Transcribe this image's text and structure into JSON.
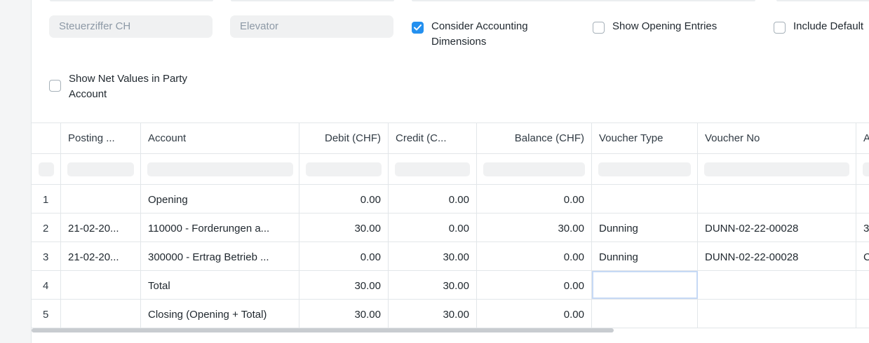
{
  "filters": {
    "tax_number_placeholder": "Steuerziffer CH",
    "elevator_placeholder": "Elevator",
    "checkboxes": [
      {
        "label": "Consider Accounting Dimensions",
        "checked": true
      },
      {
        "label": "Show Opening Entries",
        "checked": false
      },
      {
        "label": "Include Default",
        "checked": false
      },
      {
        "label": "Show Net Values in Party Account",
        "checked": false
      }
    ]
  },
  "table": {
    "columns": [
      "Posting ...",
      "Account",
      "Debit (CHF)",
      "Credit (C...",
      "Balance (CHF)",
      "Voucher Type",
      "Voucher No",
      "A"
    ],
    "rows": [
      {
        "num": "1",
        "posting": "",
        "account": "Opening",
        "debit": "0.00",
        "credit": "0.00",
        "balance": "0.00",
        "voucher_type": "",
        "voucher_no": "",
        "extra": ""
      },
      {
        "num": "2",
        "posting": "21-02-20...",
        "account": "110000 - Forderungen a...",
        "debit": "30.00",
        "credit": "0.00",
        "balance": "30.00",
        "voucher_type": "Dunning",
        "voucher_no": "DUNN-02-22-00028",
        "extra": "3"
      },
      {
        "num": "3",
        "posting": "21-02-20...",
        "account": "300000 - Ertrag Betrieb ...",
        "debit": "0.00",
        "credit": "30.00",
        "balance": "0.00",
        "voucher_type": "Dunning",
        "voucher_no": "DUNN-02-22-00028",
        "extra": "C"
      },
      {
        "num": "4",
        "posting": "",
        "account": "Total",
        "debit": "30.00",
        "credit": "30.00",
        "balance": "0.00",
        "voucher_type": "",
        "voucher_no": "",
        "extra": ""
      },
      {
        "num": "5",
        "posting": "",
        "account": "Closing (Opening + Total)",
        "debit": "30.00",
        "credit": "30.00",
        "balance": "0.00",
        "voucher_type": "",
        "voucher_no": "",
        "extra": ""
      }
    ]
  },
  "colors": {
    "accent": "#2490ef",
    "border": "#e2e6e9",
    "input_bg": "#f0f1f2"
  }
}
